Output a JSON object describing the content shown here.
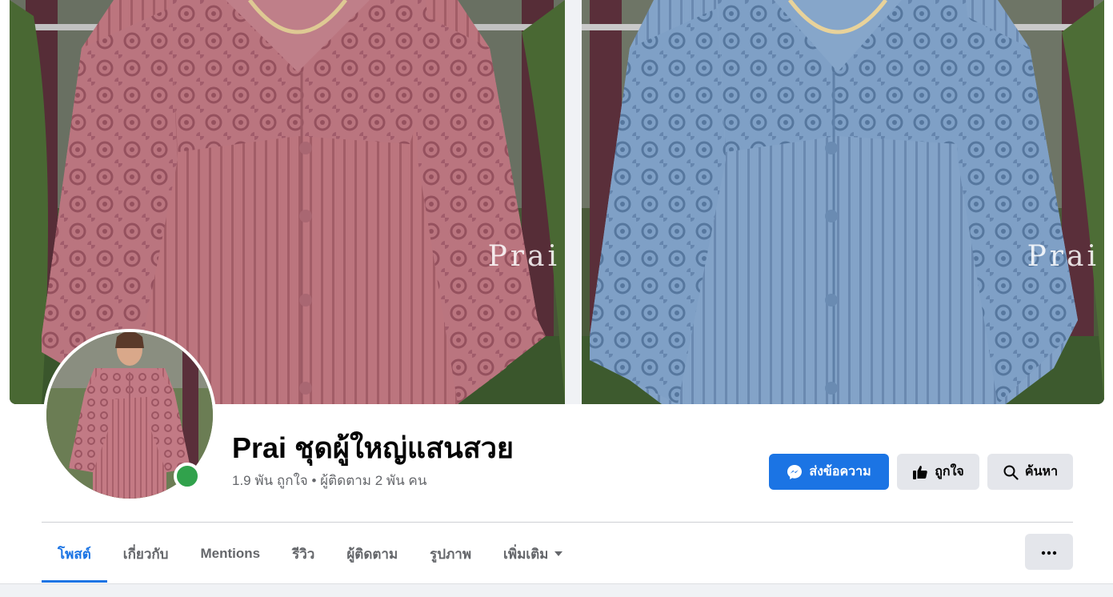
{
  "cover": {
    "left_photo_watermark": "Prai",
    "right_photo_watermark": "Prai",
    "left_blouse_color": "#c07680",
    "right_blouse_color": "#7f9fc4"
  },
  "profile": {
    "name": "Prai ชุดผู้ใหญ่แสนสวย",
    "stats": "1.9 พัน ถูกใจ • ผู้ติดตาม 2 พัน คน",
    "online": true
  },
  "actions": {
    "message_label": "ส่งข้อความ",
    "like_label": "ถูกใจ",
    "search_label": "ค้นหา"
  },
  "tabs": [
    {
      "label": "โพสต์",
      "active": true
    },
    {
      "label": "เกี่ยวกับ",
      "active": false
    },
    {
      "label": "Mentions",
      "active": false
    },
    {
      "label": "รีวิว",
      "active": false
    },
    {
      "label": "ผู้ติดตาม",
      "active": false
    },
    {
      "label": "รูปภาพ",
      "active": false
    },
    {
      "label": "เพิ่มเติม",
      "active": false
    }
  ],
  "colors": {
    "accent": "#1b74e4",
    "secondary_button": "#e4e6eb",
    "online": "#31a24c",
    "muted_text": "#65676b"
  },
  "icons": {
    "message": "messenger-icon",
    "like": "thumbs-up-icon",
    "search": "search-icon",
    "more_tab": "caret-down-icon",
    "menu": "more-dots-icon"
  }
}
